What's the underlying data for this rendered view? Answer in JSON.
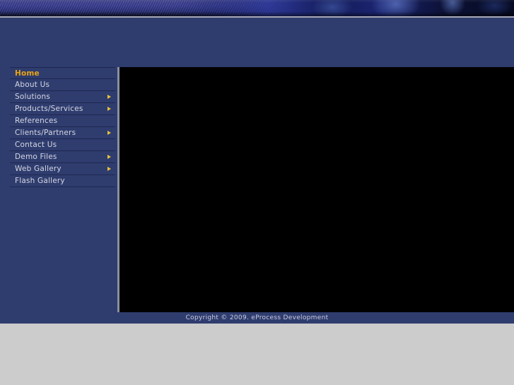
{
  "site": {
    "background_color": "#2f3c6e",
    "accent_color": "#e8a417",
    "stage_color": "#000000",
    "page_background": "#cccccc"
  },
  "banner": {
    "name": "header-banner",
    "stripe_color": "#3c3f86",
    "photo_color": "#1c2470"
  },
  "menu": {
    "items": [
      {
        "label": "Home",
        "active": true,
        "submenu": false
      },
      {
        "label": "About Us",
        "active": false,
        "submenu": false
      },
      {
        "label": "Solutions",
        "active": false,
        "submenu": true
      },
      {
        "label": "Products/Services",
        "active": false,
        "submenu": true
      },
      {
        "label": "References",
        "active": false,
        "submenu": false
      },
      {
        "label": "Clients/Partners",
        "active": false,
        "submenu": true
      },
      {
        "label": "Contact Us",
        "active": false,
        "submenu": false
      },
      {
        "label": "Demo Files",
        "active": false,
        "submenu": true
      },
      {
        "label": "Web Gallery",
        "active": false,
        "submenu": true
      },
      {
        "label": "Flash Gallery",
        "active": false,
        "submenu": false
      }
    ]
  },
  "footer": {
    "copyright": "Copyright © 2009. eProcess Development"
  }
}
